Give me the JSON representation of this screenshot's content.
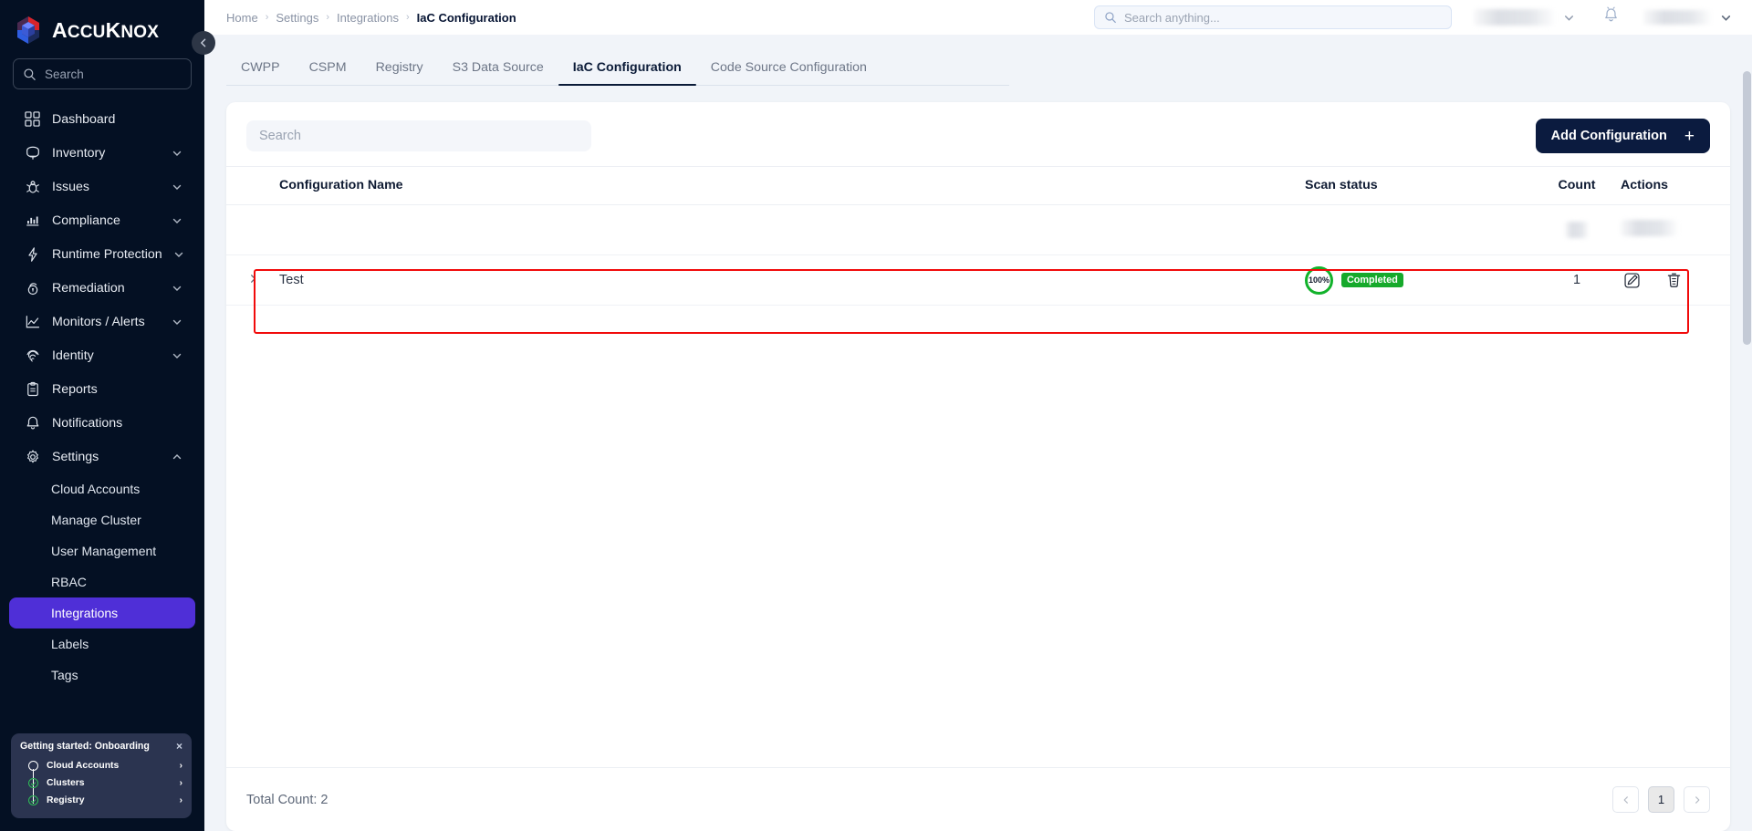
{
  "brand": {
    "name_cap": "A",
    "name_rest": "CCU",
    "name_k": "K",
    "name_nox": "NOX",
    "full": "AccuKnox"
  },
  "sidebar": {
    "search_placeholder": "Search",
    "items": [
      {
        "label": "Dashboard",
        "icon": "dashboard-icon",
        "expandable": false
      },
      {
        "label": "Inventory",
        "icon": "inventory-icon",
        "expandable": true
      },
      {
        "label": "Issues",
        "icon": "bug-icon",
        "expandable": true
      },
      {
        "label": "Compliance",
        "icon": "compliance-icon",
        "expandable": true
      },
      {
        "label": "Runtime Protection",
        "icon": "bolt-icon",
        "expandable": true
      },
      {
        "label": "Remediation",
        "icon": "lock-icon",
        "expandable": true
      },
      {
        "label": "Monitors / Alerts",
        "icon": "chart-line-icon",
        "expandable": true
      },
      {
        "label": "Identity",
        "icon": "fingerprint-icon",
        "expandable": true
      },
      {
        "label": "Reports",
        "icon": "report-icon",
        "expandable": false
      },
      {
        "label": "Notifications",
        "icon": "bell-icon",
        "expandable": false
      },
      {
        "label": "Settings",
        "icon": "gear-icon",
        "expandable": true,
        "expanded": true
      }
    ],
    "settings_children": [
      {
        "label": "Cloud Accounts",
        "active": false
      },
      {
        "label": "Manage Cluster",
        "active": false
      },
      {
        "label": "User Management",
        "active": false
      },
      {
        "label": "RBAC",
        "active": false
      },
      {
        "label": "Integrations",
        "active": true
      },
      {
        "label": "Labels",
        "active": false
      },
      {
        "label": "Tags",
        "active": false
      }
    ],
    "onboarding": {
      "title": "Getting started: Onboarding",
      "close_label": "×",
      "steps": [
        {
          "label": "Cloud Accounts",
          "done": false,
          "arrow": "›"
        },
        {
          "label": "Clusters",
          "done": true,
          "arrow": "›"
        },
        {
          "label": "Registry",
          "done": true,
          "arrow": "›"
        }
      ]
    },
    "collapse_icon": "chevron-left-icon"
  },
  "topbar": {
    "breadcrumb": [
      "Home",
      "Settings",
      "Integrations",
      "IaC Configuration"
    ],
    "separator": "›",
    "search_placeholder": "Search anything...",
    "search_value": "",
    "bell_icon": "notification-bell-icon",
    "tenant_selector_redacted": true,
    "user_selector_redacted": true
  },
  "tabs": [
    {
      "label": "CWPP",
      "active": false
    },
    {
      "label": "CSPM",
      "active": false
    },
    {
      "label": "Registry",
      "active": false
    },
    {
      "label": "S3 Data Source",
      "active": false
    },
    {
      "label": "IaC Configuration",
      "active": true
    },
    {
      "label": "Code Source Configuration",
      "active": false
    }
  ],
  "toolbar": {
    "search_placeholder": "Search",
    "search_value": "",
    "add_label": "Add Configuration",
    "add_icon": "plus-icon"
  },
  "table": {
    "columns": [
      "Configuration Name",
      "Scan status",
      "Count",
      "Actions"
    ],
    "rows": [
      {
        "redacted": true,
        "name": "",
        "scan_percent": "",
        "scan_status": "",
        "count": "",
        "expand_icon": "chevron-right-icon"
      },
      {
        "redacted": false,
        "highlighted": true,
        "name": "Test",
        "scan_percent": "100%",
        "scan_status": "Completed",
        "count": "1",
        "expand_icon": "chevron-right-icon",
        "edit_icon": "edit-pencil-icon",
        "delete_icon": "trash-icon"
      }
    ]
  },
  "footer": {
    "total_label": "Total Count: 2",
    "prev_icon": "chevron-left-icon",
    "next_icon": "chevron-right-icon",
    "pages": [
      "1"
    ],
    "current_page": "1"
  },
  "colors": {
    "sidebar_bg": "#041023",
    "active_nav": "#4f2fd7",
    "accent_dark": "#0b1b3f",
    "success_green": "#16a92b",
    "highlight_red": "#f10b0b"
  }
}
